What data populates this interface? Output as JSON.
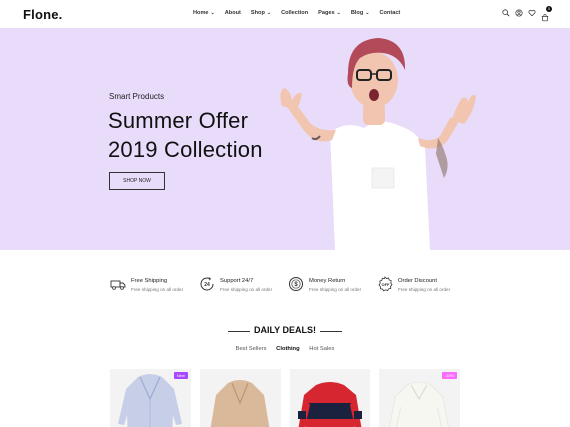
{
  "brand": {
    "logo": "Flone."
  },
  "nav": {
    "items": [
      {
        "label": "Home",
        "dropdown": true
      },
      {
        "label": "About",
        "dropdown": false
      },
      {
        "label": "Shop",
        "dropdown": true
      },
      {
        "label": "Collection",
        "dropdown": false
      },
      {
        "label": "Pages",
        "dropdown": true
      },
      {
        "label": "Blog",
        "dropdown": true
      },
      {
        "label": "Contact",
        "dropdown": false
      }
    ],
    "cart_count": "0"
  },
  "hero": {
    "subtitle": "Smart Products",
    "title_line1": "Summer Offer",
    "title_line2": "2019 Collection",
    "button": "SHOP NOW",
    "bg_color": "#e8dcfa"
  },
  "features": [
    {
      "icon": "truck-icon",
      "title": "Free Shipping",
      "desc": "Free shipping on all order"
    },
    {
      "icon": "support-24-icon",
      "title": "Support 24/7",
      "desc": "Free shipping on all order"
    },
    {
      "icon": "money-return-icon",
      "title": "Money Return",
      "desc": "Free shipping on all order"
    },
    {
      "icon": "discount-icon",
      "title": "Order Discount",
      "desc": "Free shipping on all order"
    }
  ],
  "deals": {
    "title": "DAILY DEALS!",
    "tabs": [
      "Best Sellers",
      "Clothing",
      "Hot Sales"
    ],
    "active_tab": "Clothing"
  },
  "products": [
    {
      "badge": "New",
      "badge_color": "#a749ff"
    },
    {
      "badge": "",
      "badge_color": ""
    },
    {
      "badge": "",
      "badge_color": ""
    },
    {
      "badge": "-10%",
      "badge_color": "#fa6bff"
    }
  ]
}
